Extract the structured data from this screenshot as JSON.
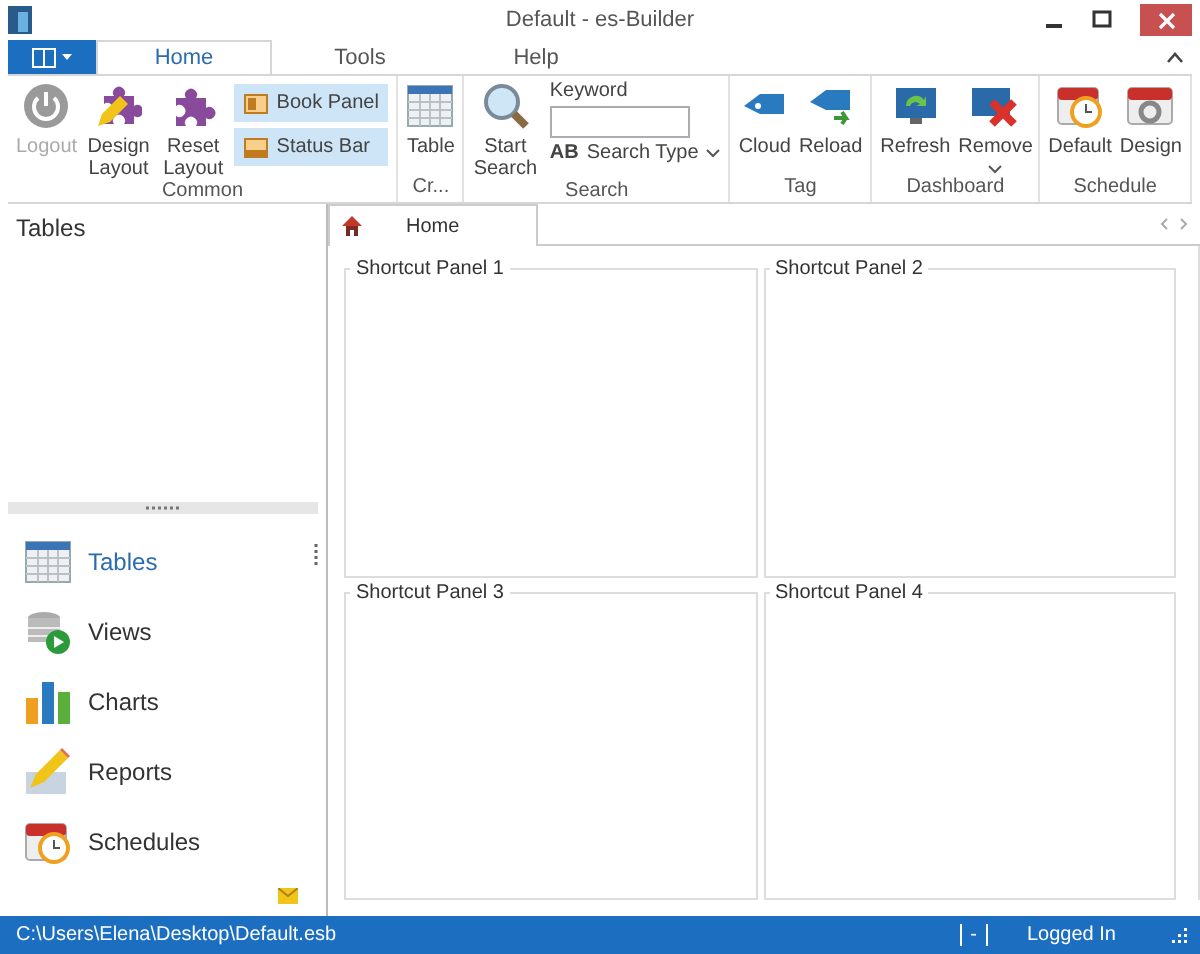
{
  "window": {
    "title": "Default - es-Builder"
  },
  "ribbon_tabs": [
    {
      "label": "Home",
      "selected": true
    },
    {
      "label": "Tools",
      "selected": false
    },
    {
      "label": "Help",
      "selected": false
    }
  ],
  "ribbon_groups": [
    {
      "label": "Common",
      "items": [
        {
          "kind": "large",
          "label": "Logout",
          "disabled": true
        },
        {
          "kind": "large",
          "label": "Design Layout",
          "disabled": false
        },
        {
          "kind": "large",
          "label": "Reset Layout",
          "disabled": false
        },
        {
          "kind": "toggles",
          "toggles": [
            {
              "label": "Book Panel",
              "checked": true
            },
            {
              "label": "Status Bar",
              "checked": true
            }
          ]
        }
      ]
    },
    {
      "label": "Cr...",
      "items": [
        {
          "kind": "large",
          "label": "Table",
          "disabled": false
        }
      ]
    },
    {
      "label": "Search",
      "items": [
        {
          "kind": "large",
          "label": "Start Search",
          "disabled": false
        },
        {
          "kind": "search",
          "label": "Keyword",
          "dropdown": "Search Type",
          "dropdown_mark": "AB"
        }
      ]
    },
    {
      "label": "Tag",
      "items": [
        {
          "kind": "large",
          "label": "Cloud",
          "disabled": false
        },
        {
          "kind": "large",
          "label": "Reload",
          "disabled": false
        }
      ]
    },
    {
      "label": "Dashboard",
      "items": [
        {
          "kind": "large",
          "label": "Refresh",
          "disabled": false
        },
        {
          "kind": "menu",
          "label": "Remove",
          "disabled": false
        }
      ]
    },
    {
      "label": "Schedule",
      "items": [
        {
          "kind": "large",
          "label": "Default",
          "disabled": false
        },
        {
          "kind": "large",
          "label": "Design",
          "disabled": false
        }
      ]
    }
  ],
  "left_panel": {
    "title": "Tables",
    "nav_items": [
      {
        "label": "Tables",
        "selected": true
      },
      {
        "label": "Views",
        "selected": false
      },
      {
        "label": "Charts",
        "selected": false
      },
      {
        "label": "Reports",
        "selected": false
      },
      {
        "label": "Schedules",
        "selected": false
      }
    ]
  },
  "document_tabs": [
    {
      "label": "Home",
      "selected": true
    }
  ],
  "shortcut_panels": [
    {
      "title": "Shortcut Panel 1"
    },
    {
      "title": "Shortcut Panel 2"
    },
    {
      "title": "Shortcut Panel 3"
    },
    {
      "title": "Shortcut Panel 4"
    }
  ],
  "status_bar": {
    "path": "C:\\Users\\Elena\\Desktop\\Default.esb",
    "indicator": "-",
    "user_status": "Logged In"
  }
}
